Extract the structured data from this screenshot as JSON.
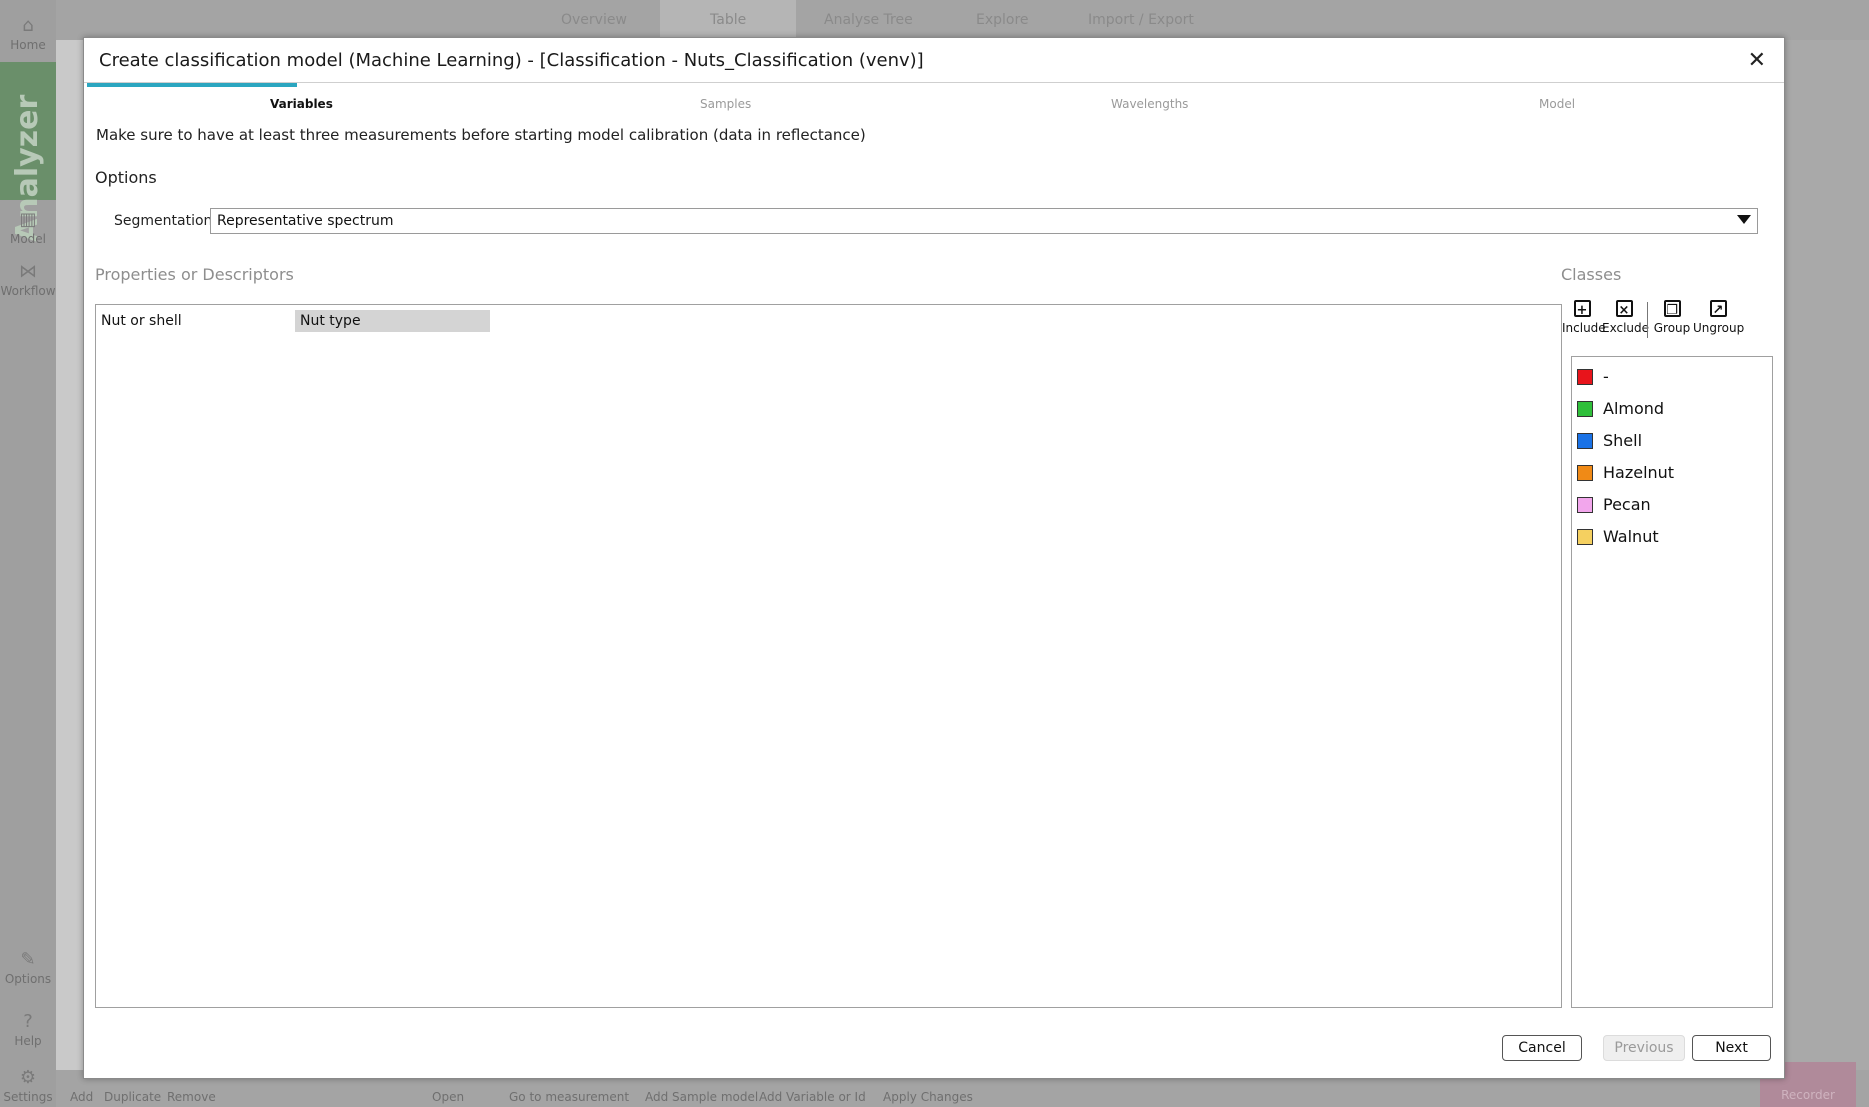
{
  "app": {
    "nav": {
      "home": "Home",
      "analyzer": "Analyzer",
      "model": "Model",
      "workflow": "Workflow",
      "options": "Options",
      "help": "Help",
      "settings": "Settings"
    },
    "top_tabs": [
      "Overview",
      "Table",
      "Analyse Tree",
      "Explore",
      "Import / Export"
    ],
    "bottom_toolbar": [
      "Add",
      "Duplicate",
      "Remove",
      "Open",
      "Go to measurement",
      "Add Sample model",
      "Add Variable or Id",
      "Apply Changes",
      "Recorder"
    ]
  },
  "dialog": {
    "title": "Create classification model (Machine Learning) - [Classification - Nuts_Classification (venv)]",
    "close_symbol": "✕",
    "steps": [
      "Variables",
      "Samples",
      "Wavelengths",
      "Model"
    ],
    "active_step": "Variables",
    "accent_color": "#2ba6c0",
    "instruction": "Make sure to have at least three measurements before starting model calibration (data in reflectance)",
    "options_heading": "Options",
    "segmentation_label": "Segmentation",
    "segmentation_value": "Representative spectrum",
    "properties_heading": "Properties or Descriptors",
    "properties": [
      "Nut or shell",
      "Nut type"
    ],
    "selected_property": "Nut type",
    "classes_heading": "Classes",
    "class_toolbar": [
      "Include",
      "Exclude",
      "Group",
      "Ungroup"
    ],
    "classes": [
      {
        "label": "-",
        "color": "#e8141b"
      },
      {
        "label": "Almond",
        "color": "#2fbf3a"
      },
      {
        "label": "Shell",
        "color": "#1a72e6"
      },
      {
        "label": "Hazelnut",
        "color": "#f08a16"
      },
      {
        "label": "Pecan",
        "color": "#f2a6ec"
      },
      {
        "label": "Walnut",
        "color": "#f5d060"
      }
    ],
    "buttons": {
      "cancel": "Cancel",
      "previous": "Previous",
      "next": "Next"
    }
  }
}
